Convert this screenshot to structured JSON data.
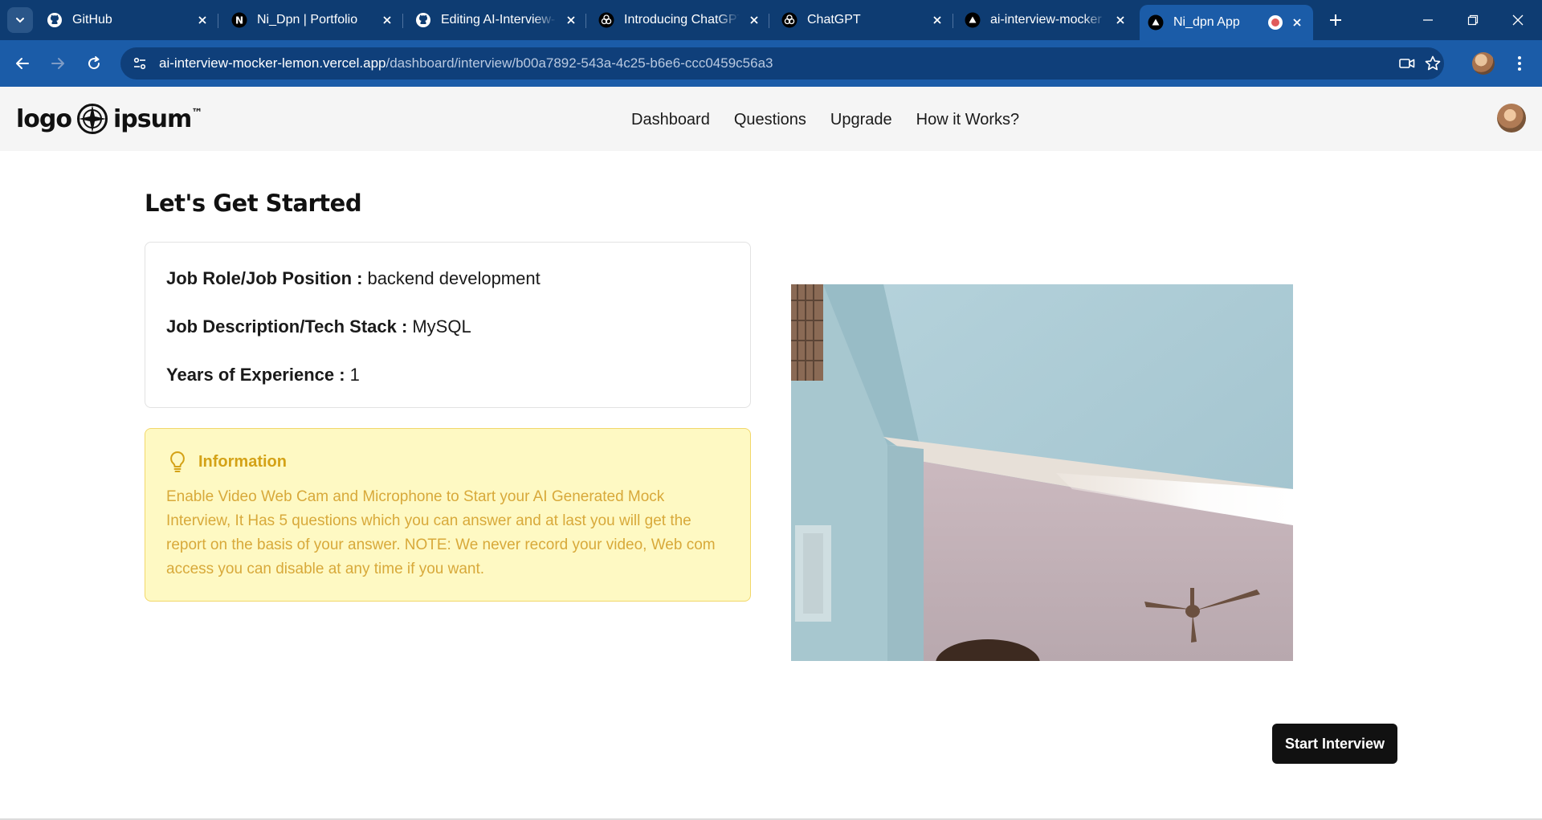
{
  "browser": {
    "tabs": [
      {
        "title": "GitHub",
        "icon": "github-icon"
      },
      {
        "title": "Ni_Dpn | Portfolio",
        "icon": "n-logo-icon"
      },
      {
        "title": "Editing AI-Interview-M",
        "icon": "github-icon"
      },
      {
        "title": "Introducing ChatGPT",
        "icon": "openai-icon"
      },
      {
        "title": "ChatGPT",
        "icon": "openai-icon"
      },
      {
        "title": "ai-interview-mocker",
        "icon": "vercel-icon"
      },
      {
        "title": "Ni_dpn App",
        "icon": "vercel-icon",
        "active": true,
        "recording": true
      }
    ],
    "url_host": "ai-interview-mocker-lemon.vercel.app",
    "url_path": "/dashboard/interview/b00a7892-543a-4c25-b6e6-ccc0459c56a3"
  },
  "header": {
    "logo_left": "logo",
    "logo_right": "ipsum",
    "logo_tm": "™",
    "nav": [
      "Dashboard",
      "Questions",
      "Upgrade",
      "How it Works?"
    ]
  },
  "main": {
    "title": "Let's Get Started",
    "details": [
      {
        "label": "Job Role/Job Position :",
        "value": "backend development"
      },
      {
        "label": "Job Description/Tech Stack :",
        "value": "MySQL"
      },
      {
        "label": "Years of Experience :",
        "value": "1"
      }
    ],
    "info": {
      "title": "Information",
      "text": "Enable Video Web Cam and Microphone to Start your AI Generated Mock Interview, It Has 5 questions which you can answer and at last you will get the report on the basis of your answer. NOTE: We never record your video, Web com access you can disable at any time if you want."
    },
    "start_button": "Start Interview"
  },
  "colors": {
    "tab_bar": "#0e3c72",
    "toolbar": "#1b5ca8",
    "info_bg": "#fef9c3",
    "info_text": "#d4a217",
    "button_bg": "#111111"
  }
}
